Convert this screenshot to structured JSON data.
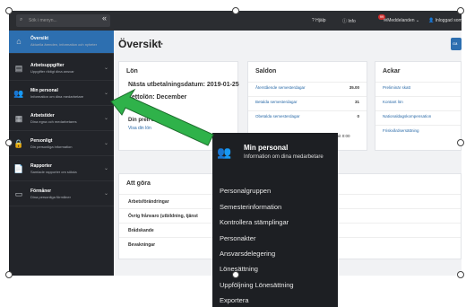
{
  "topbar": {
    "search_placeholder": "Sök i menyn...",
    "collapse": "«",
    "help": "Hjälp",
    "info": "Info",
    "badge": "99",
    "messages": "Meddelanden ⌄",
    "user": "Inloggad som"
  },
  "sidebar": {
    "items": [
      {
        "title": "Översikt",
        "sub": "Aktuella ärenden, information och nyheter",
        "icon": "home-icon",
        "glyph": "⌂"
      },
      {
        "title": "Arbetsuppgifter",
        "sub": "Uppgifter riktigt dina ansvar",
        "icon": "briefcase-icon",
        "glyph": "▤"
      },
      {
        "title": "Min personal",
        "sub": "Information om dina medarbetare",
        "icon": "people-icon",
        "glyph": "👥"
      },
      {
        "title": "Arbetstider",
        "sub": "Dina egna och medarbetares",
        "icon": "calendar-icon",
        "glyph": "▦"
      },
      {
        "title": "Personligt",
        "sub": "Din personliga information",
        "icon": "lock-icon",
        "glyph": "🔒"
      },
      {
        "title": "Rapporter",
        "sub": "Samlade rapporter om sökda",
        "icon": "report-icon",
        "glyph": "📄"
      },
      {
        "title": "Förmåner",
        "sub": "Dina personliga förmåner",
        "icon": "benefits-icon",
        "glyph": "▭"
      }
    ]
  },
  "main": {
    "title": "Översikt",
    "title_icons": "☆ ▪",
    "right_button": "Gå",
    "lon": {
      "heading": "Lön",
      "next_date": "Nästa utbetalningsdatum: 2019-01-25",
      "next_month": "settolön: December",
      "prelim": "Din preli                  uari",
      "link": "Visa din lön"
    },
    "saldon": {
      "heading": "Saldon",
      "rows": [
        {
          "label": "Återstående semesterdagar",
          "value": "35.00"
        },
        {
          "label": "Betalda semesterdagar",
          "value": "31"
        },
        {
          "label": "Obetalda semesterdagar",
          "value": "0"
        }
      ],
      "extra": "ersit 0:00"
    },
    "ackar": {
      "heading": "Ackar",
      "rows": [
        "Preliminär skatt",
        "Kontant lön",
        "Nationaldagskompensation",
        "Friskvårdsersättning"
      ]
    },
    "att_gora": {
      "heading": "Att göra",
      "rows": [
        "Arbetsförändringar",
        "Övrig frånvaro (utbildning, tjänst",
        "Brådskande",
        "Bevakningar"
      ]
    }
  },
  "menu": {
    "title": "Min personal",
    "sub": "Information om dina medarbetare",
    "items": [
      "Personalgruppen",
      "Semesterinformation",
      "Kontrollera stämplingar",
      "Personakter",
      "Ansvarsdelegering",
      "Lönesättning",
      "Uppföljning Lönesättning",
      "Exportera"
    ]
  },
  "colors": {
    "accent": "#2d6fb0",
    "arrow": "#2fb24a",
    "sidebar": "#222429"
  }
}
